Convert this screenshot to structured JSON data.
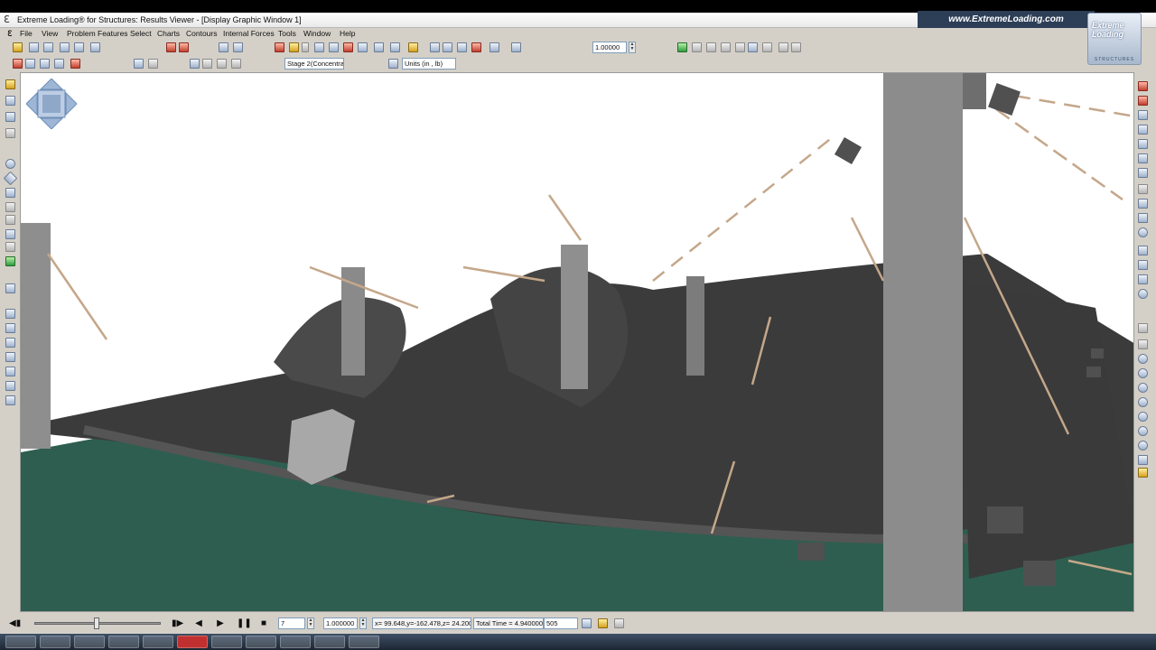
{
  "window": {
    "title": "Extreme Loading® for Structures: Results Viewer - [Display Graphic Window 1]",
    "brand_url": "www.ExtremeLoading.com",
    "logo_text_top": "Extreme Loading",
    "logo_text_bottom": "STRUCTURES"
  },
  "menubar": {
    "items": [
      "File",
      "View",
      "Problem Features",
      "Select",
      "Charts",
      "Contours",
      "Internal Forces",
      "Tools",
      "Window",
      "Help"
    ]
  },
  "toolbar": {
    "scale_value": "1.00000",
    "stage_value": "Stage 2(Concentra",
    "units_value": "Units (in , lb)"
  },
  "statusbar": {
    "step_value": "7",
    "speed_value": "1.000000",
    "coords_text": "x= 99.648,y=-162.478,z= 24.200",
    "total_time_text": "Total Time = 4.940000",
    "frame_value": "505"
  },
  "colors": {
    "ground": "#2e5e4f",
    "slab": "#3b3b3b",
    "column": "#8c8c8c",
    "rebar": "#c4a78a",
    "accent": "#2d3e57"
  },
  "icons": {
    "play_first": "step-back-icon",
    "play_reverse": "play-reverse-icon",
    "play": "play-icon",
    "pause": "pause-icon",
    "stop": "stop-icon"
  }
}
